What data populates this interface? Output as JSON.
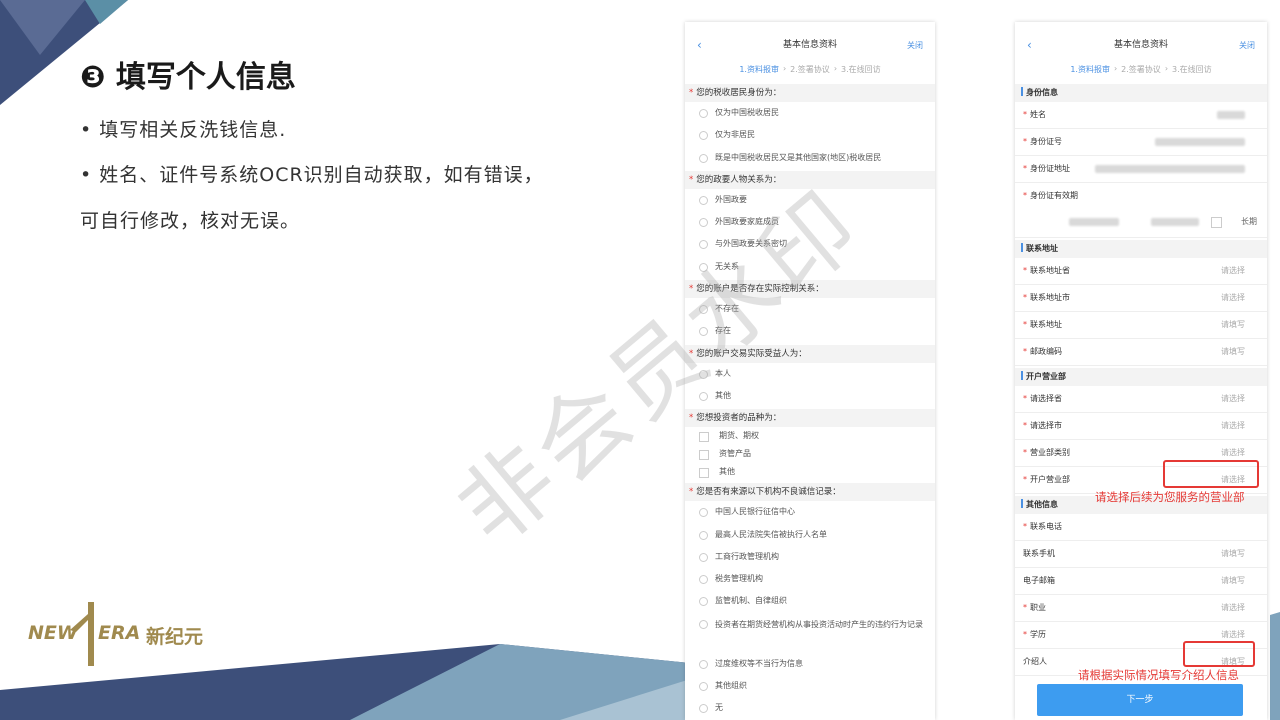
{
  "slide": {
    "title": "❸ 填写个人信息",
    "bullets": [
      "• 填写相关反洗钱信息.",
      "• 姓名、证件号系统OCR识别自动获取，如有错误，",
      "可自行修改，核对无误。"
    ]
  },
  "logo": {
    "left": "NEW",
    "right": "ERA",
    "cn": "新纪元"
  },
  "header": {
    "back": "‹",
    "title": "基本信息资料",
    "close": "关闭"
  },
  "steps": [
    "1.资料报审",
    "›",
    "2.签署协议",
    "›",
    "3.在线回访"
  ],
  "left_form": {
    "q1": "您的税收居民身份为：",
    "q1_opts": [
      "仅为中国税收居民",
      "仅为非居民",
      "既是中国税收居民又是其他国家(地区)税收居民"
    ],
    "q2": "您的政要人物关系为：",
    "q2_opts": [
      "外国政要",
      "外国政要家庭成员",
      "与外国政要关系密切",
      "无关系"
    ],
    "q3": "您的账户是否存在实际控制关系：",
    "q3_opts": [
      "不存在",
      "存在"
    ],
    "q4": "您的账户交易实际受益人为：",
    "q4_opts": [
      "本人",
      "其他"
    ],
    "q5": "您想投资者的品种为：",
    "q5_opts": [
      "期货、期权",
      "资管产品",
      "其他"
    ],
    "q6": "您是否有来源以下机构不良诚信记录：",
    "q6_opts": [
      "中国人民银行征信中心",
      "最高人民法院失信被执行人名单",
      "工商行政管理机构",
      "税务管理机构",
      "监管机制、自律组织",
      "投资者在期货经营机构从事投资活动时产生的违约行为记录",
      "过度维权等不当行为信息",
      "其他组织",
      "无"
    ]
  },
  "right_form": {
    "sec_id": "身份信息",
    "name": "姓名",
    "id_no": "身份证号",
    "id_addr": "身份证地址",
    "id_valid": "身份证有效期",
    "long_term": "长期",
    "sec_contact": "联系地址",
    "province": "联系地址省",
    "city": "联系地址市",
    "address": "联系地址",
    "postcode": "邮政编码",
    "sec_branch": "开户营业部",
    "sel_province": "请选择省",
    "sel_city": "请选择市",
    "branch_type": "营业部类别",
    "branch": "开户营业部",
    "sec_other": "其他信息",
    "phone": "联系电话",
    "mobile": "联系手机",
    "email": "电子邮箱",
    "job": "职业",
    "edu": "学历",
    "referrer": "介绍人",
    "select": "请选择",
    "fill": "请填写",
    "next": "下一步"
  },
  "notes": {
    "branch": "请选择后续为您服务的营业部",
    "referrer": "请根据实际情况填写介绍人信息"
  },
  "watermark": "非会员水印"
}
